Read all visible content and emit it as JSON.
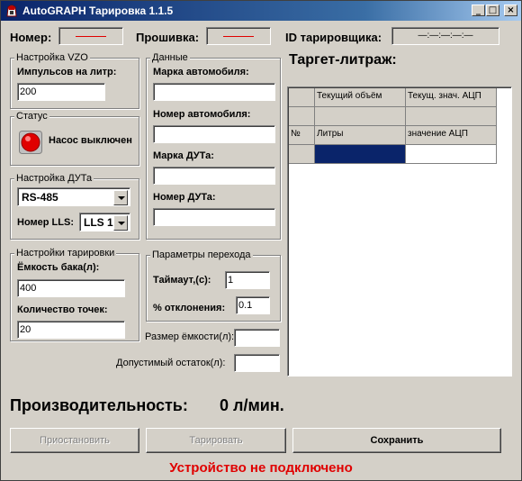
{
  "window": {
    "title": "AutoGRAPH Тарировка 1.1.5",
    "min": "_",
    "max": "□",
    "close": "×"
  },
  "header": {
    "nomer_label": "Номер:",
    "firmware_label": "Прошивка:",
    "taruser_label": "ID тарировщика:",
    "taruser_value": "—:—:—:—:—"
  },
  "vzo": {
    "caption": "Настройка VZO",
    "pulses_label": "Импульсов на литр:",
    "pulses_value": "200"
  },
  "status": {
    "caption": "Статус",
    "pump_text": "Насос выключен",
    "indicator_color": "#e00000"
  },
  "dut": {
    "caption": "Настройка ДУТа",
    "interface_value": "RS-485",
    "lls_label": "Номер LLS:",
    "lls_value": "LLS 1"
  },
  "tar": {
    "caption": "Настройки тарировки",
    "capacity_label": "Ёмкость бака(л):",
    "capacity_value": "400",
    "points_label": "Количество точек:",
    "points_value": "20"
  },
  "data": {
    "caption": "Данные",
    "car_brand_label": "Марка автомобиля:",
    "car_number_label": "Номер автомобиля:",
    "dut_brand_label": "Марка ДУТа:",
    "dut_number_label": "Номер ДУТа:"
  },
  "transition": {
    "caption": "Параметры перехода",
    "timeout_label": "Таймаут,(с):",
    "timeout_value": "1",
    "deviation_label": "% отклонения:",
    "deviation_value": "0.1"
  },
  "extra": {
    "size_label": "Размер ёмкости(л):",
    "remainder_label": "Допустимый остаток(л):"
  },
  "target": {
    "title": "Таргет-литраж:",
    "header_row": [
      "Текущий объём",
      "Текущ. знач. АЦП"
    ],
    "columns": [
      "№",
      "Литры",
      "значение АЦП"
    ]
  },
  "performance": {
    "label": "Производительность:",
    "value": "0 л/мин."
  },
  "buttons": {
    "pause": "Приостановить",
    "calibrate": "Тарировать",
    "save": "Сохранить"
  },
  "footer": {
    "status_text": "Устройство не подключено",
    "status_color": "#e00000"
  }
}
